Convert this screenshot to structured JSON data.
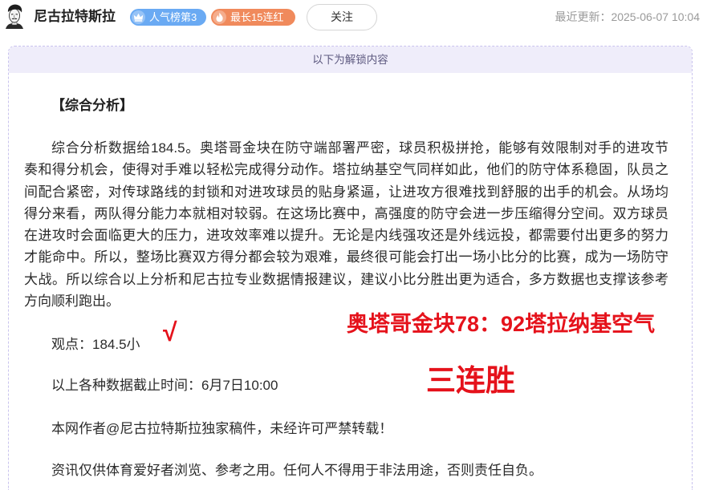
{
  "header": {
    "author_name": "尼古拉特斯拉",
    "badges": [
      {
        "label": "人气榜第3",
        "icon": "crown-icon",
        "color": "#6aaaf3"
      },
      {
        "label": "最长15连红",
        "icon": "flame-icon",
        "color": "#f08a5c"
      }
    ],
    "follow_label": "关注",
    "updated_prefix": "最近更新：",
    "updated_time": "2025-06-07 10:04"
  },
  "unlock_banner": "以下为解锁内容",
  "article": {
    "section_title": "【综合分析】",
    "analysis_lines": [
      "综合分析数据给184.5。奥塔哥金块在防守端部署严密，球员积极拼抢，能够有效限制对手的进攻节",
      "奏和得分机会，使得对手难以轻松完成得分动作。塔拉纳基空气同样如此，他们的防守体系稳固，队员之",
      "间配合紧密，对传球路线的封锁和对进攻球员的贴身紧逼，让进攻方很难找到舒服的出手的机会。从场均",
      "得分来看，两队得分能力本就相对较弱。在这场比赛中，高强度的防守会进一步压缩得分空间。双方球员",
      "在进攻时会面临更大的压力，进攻效率难以提升。无论是内线强攻还是外线远投，都需要付出更多的努力",
      "才能命中。所以，整场比赛双方得分都会较为艰难，最终很可能会打出一场小比分的比赛，成为一场防守",
      "大战。所以综合以上分析和尼古拉专业数据情报建议，建议小比分胜出更为适合，多方数据也支撑该参考",
      "方向顺利跑出。"
    ],
    "opinion": "观点：184.5小",
    "verdict_mark": "√",
    "deadline": "以上各种数据截止时间：6月7日10:00",
    "copyright": "本网作者@尼古拉特斯拉独家稿件，未经许可严禁转载！",
    "disclaimer": "资讯仅供体育爱好者浏览、参考之用。任何人不得用于非法用途，否则责任自负。"
  },
  "overlay": {
    "score": "奥塔哥金块78：92塔拉纳基空气",
    "streak": "三连胜"
  },
  "colors": {
    "accent_red": "#e5121b",
    "banner_bg": "#efedfa",
    "box_border": "#c9c3ee"
  }
}
